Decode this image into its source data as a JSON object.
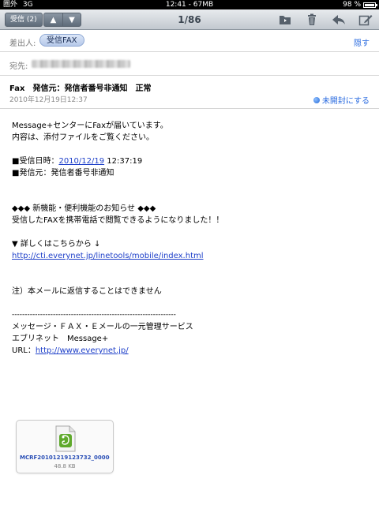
{
  "status_bar": {
    "carrier": "圏外",
    "network": "3G",
    "time_title": "12:41 - 67MB",
    "battery": "98 %",
    "battery_level": 0.98
  },
  "toolbar": {
    "inbox_label": "受信 (2)",
    "prev_arrow": "▲",
    "next_arrow": "▼",
    "counter": "1/86"
  },
  "header": {
    "from_label": "差出人:",
    "from_name": "受信FAX",
    "hide_label": "隠す",
    "to_label": "宛先:",
    "subject": "Fax　発信元：発信者番号非通知　正常",
    "date": "2010年12月19日12:37",
    "mark_unread_label": "未開封にする"
  },
  "body": {
    "line1": "Message+センターにFaxが届いています。",
    "line2": "内容は、添付ファイルをご覧ください。",
    "received_prefix": "■受信日時：",
    "received_date_link": "2010/12/19",
    "received_time": " 12:37:19",
    "sender_line": "■発信元：発信者番号非通知",
    "news_heading": "◆◆◆ 新機能・便利機能のお知らせ ◆◆◆",
    "news_text": "受信したFAXを携帯電話で閲覧できるようになりました！！",
    "details_label": "▼ 詳しくはこちらから ↓",
    "details_url": "http://cti.everynet.jp/linetools/mobile/index.html",
    "note": "注）本メールに返信することはできません",
    "separator": "----------------------------------------------------------------",
    "service_name": "メッセージ・ＦＡＸ・Ｅメールの一元管理サービス",
    "company": "エブリネット　Message+",
    "url_prefix": "URL：",
    "url": "http://www.everynet.jp/"
  },
  "attachment": {
    "filename": "MCRF20101219123732_00000...",
    "size": "48.8 KB",
    "icon": "evernote-file-icon"
  }
}
